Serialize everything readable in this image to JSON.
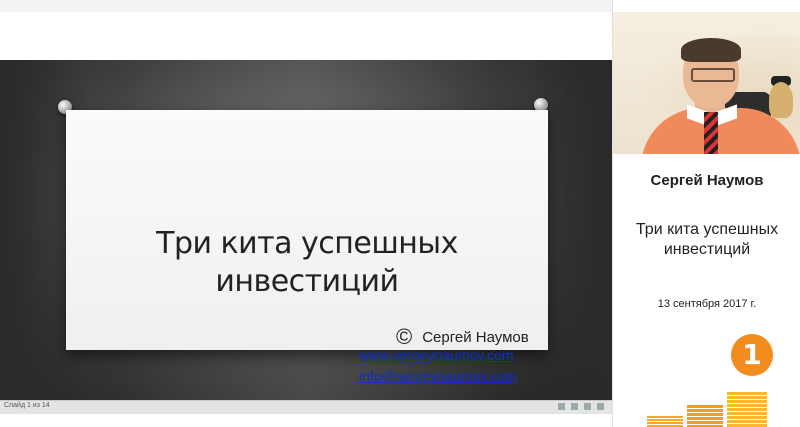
{
  "slide": {
    "title": "Три кита успешных инвестиций",
    "copyright_symbol": "©",
    "copyright_author": "Сергей Наумов",
    "website": "www.sergeynaumov.com",
    "email": "info@sergeynaumov.com"
  },
  "status_bar": {
    "slide_counter": "Слайд 1 из 14"
  },
  "side_panel": {
    "presenter_name": "Сергей Наумов",
    "talk_title": "Три кита успешных инвестиций",
    "date": "13 сентября 2017 г.",
    "badge_number": "1"
  },
  "colors": {
    "link": "#0b2fc9",
    "badge": "#f28c1e",
    "stairs": "#f5a623",
    "stage": "#3d3d3d"
  },
  "icons": [
    "pushpin-icon",
    "copyright-icon",
    "webcam-feed",
    "channel-logo-icon"
  ]
}
